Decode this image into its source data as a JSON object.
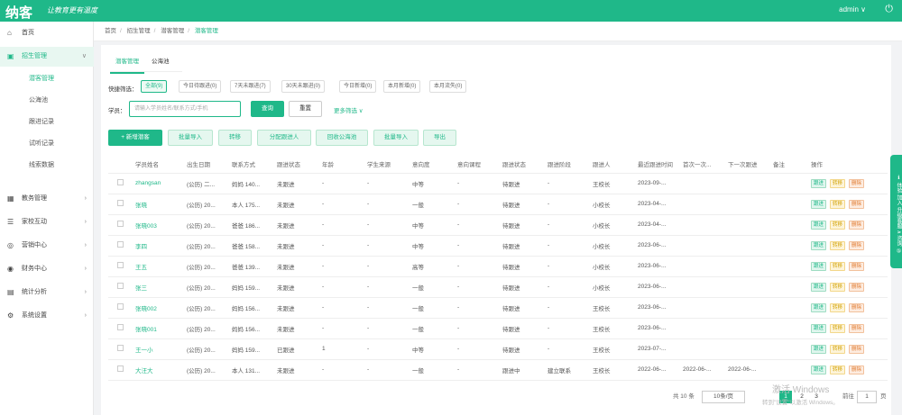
{
  "header": {
    "logo": "纳客",
    "slogan": "让教育更有温度",
    "user": "admin ∨",
    "power_icon": "power-icon"
  },
  "sidebar": {
    "items": [
      {
        "label": "首页",
        "icon": "home-icon"
      },
      {
        "label": "招生管理",
        "icon": "card-icon",
        "arrow": "∨"
      },
      {
        "label": "教务管理",
        "icon": "calendar-icon",
        "arrow": "›"
      },
      {
        "label": "家校互动",
        "icon": "chat-icon",
        "arrow": "›"
      },
      {
        "label": "营销中心",
        "icon": "chart-icon",
        "arrow": "›"
      },
      {
        "label": "财务中心",
        "icon": "money-icon",
        "arrow": "›"
      },
      {
        "label": "统计分析",
        "icon": "stats-icon",
        "arrow": "›"
      },
      {
        "label": "系统设置",
        "icon": "gear-icon",
        "arrow": "›"
      }
    ],
    "sub_items": [
      "潜客管理",
      "公海池",
      "跟进记录",
      "试听记录",
      "线索数据"
    ]
  },
  "breadcrumb": [
    "首页",
    "招生管理",
    "潜客管理",
    "潜客管理"
  ],
  "tabs": [
    "潜客管理",
    "公海池"
  ],
  "filter": {
    "label": "快捷筛选：",
    "chips": [
      "全部(9)",
      "今日待跟进(0)",
      "7天未跟进(7)",
      "30天未跟进(0)",
      "今日新增(0)",
      "本月新增(0)",
      "本月流失(0)"
    ]
  },
  "search": {
    "label": "学员：",
    "placeholder": "请输入学员姓名/联系方式/手机",
    "query": "查询",
    "reset": "重置",
    "more": "更多筛选 ∨"
  },
  "actions": [
    "+ 新增潜客",
    "批量导入",
    "转移",
    "分配跟进人",
    "回收公海池",
    "批量导入",
    "导出"
  ],
  "table": {
    "headers": [
      "",
      "学员姓名",
      "出生日期",
      "联系方式",
      "跟进状态",
      "年龄",
      "学生来源",
      "意向度",
      "意向课程",
      "跟进状态",
      "跟进阶段",
      "跟进人",
      "最近跟进时间",
      "首次一次...",
      "下一次跟进",
      "备注",
      "操作"
    ],
    "rows": [
      [
        "",
        "zhangsan",
        "(公历) 二...",
        "妈妈 140...",
        "未跟进",
        "-",
        "-",
        "中等",
        "-",
        "待跟进",
        "-",
        "王校长",
        "2023-09-...",
        "",
        "",
        "",
        ""
      ],
      [
        "",
        "张晓",
        "(公历) 20...",
        "本人 175...",
        "未跟进",
        "-",
        "-",
        "一般",
        "-",
        "待跟进",
        "-",
        "小校长",
        "2023-04-...",
        "",
        "",
        "",
        ""
      ],
      [
        "",
        "张晓003",
        "(公历) 20...",
        "爸爸 186...",
        "未跟进",
        "-",
        "-",
        "中等",
        "-",
        "待跟进",
        "-",
        "小校长",
        "2023-04-...",
        "",
        "",
        "",
        ""
      ],
      [
        "",
        "李四",
        "(公历) 20...",
        "爸爸 158...",
        "未跟进",
        "-",
        "-",
        "中等",
        "-",
        "待跟进",
        "-",
        "小校长",
        "2023-06-...",
        "",
        "",
        "",
        ""
      ],
      [
        "",
        "王五",
        "(公历) 20...",
        "爸爸 139...",
        "未跟进",
        "-",
        "-",
        "高等",
        "-",
        "待跟进",
        "-",
        "小校长",
        "2023-06-...",
        "",
        "",
        "",
        ""
      ],
      [
        "",
        "张三",
        "(公历) 20...",
        "妈妈 159...",
        "未跟进",
        "-",
        "-",
        "一般",
        "-",
        "待跟进",
        "-",
        "小校长",
        "2023-06-...",
        "",
        "",
        "",
        ""
      ],
      [
        "",
        "张晓002",
        "(公历) 20...",
        "妈妈 156...",
        "未跟进",
        "-",
        "-",
        "一般",
        "-",
        "待跟进",
        "-",
        "王校长",
        "2023-06-...",
        "",
        "",
        "",
        ""
      ],
      [
        "",
        "张晓001",
        "(公历) 20...",
        "妈妈 156...",
        "未跟进",
        "-",
        "-",
        "一般",
        "-",
        "待跟进",
        "-",
        "王校长",
        "2023-06-...",
        "",
        "",
        "",
        ""
      ],
      [
        "",
        "王一小",
        "(公历) 20...",
        "妈妈 159...",
        "已跟进",
        "1",
        "-",
        "中等",
        "-",
        "待跟进",
        "-",
        "王校长",
        "2023-07-...",
        "",
        "",
        "",
        ""
      ],
      [
        "",
        "大汪大",
        "(公历) 20...",
        "本人 131...",
        "未跟进",
        "-",
        "-",
        "一般",
        "-",
        "跟进中",
        "建立联系",
        "王校长",
        "2022-06-...",
        "2022-06-...",
        "2022-06-...",
        "",
        ""
      ]
    ],
    "ops": [
      "跟进",
      "转移",
      "删除"
    ]
  },
  "pager": {
    "total": "共 10 条",
    "pages": [
      "1",
      "2",
      "3"
    ],
    "size": "10条/页",
    "goto": "前往",
    "page_val": "1",
    "page_unit": "页"
  },
  "float_tab": "ℹ 体验 加入 升级客服 ∧ 咨询 ⑤",
  "watermark": {
    "line1": "激活 Windows",
    "line2": "转到\"设置\"以激活 Windows。"
  }
}
